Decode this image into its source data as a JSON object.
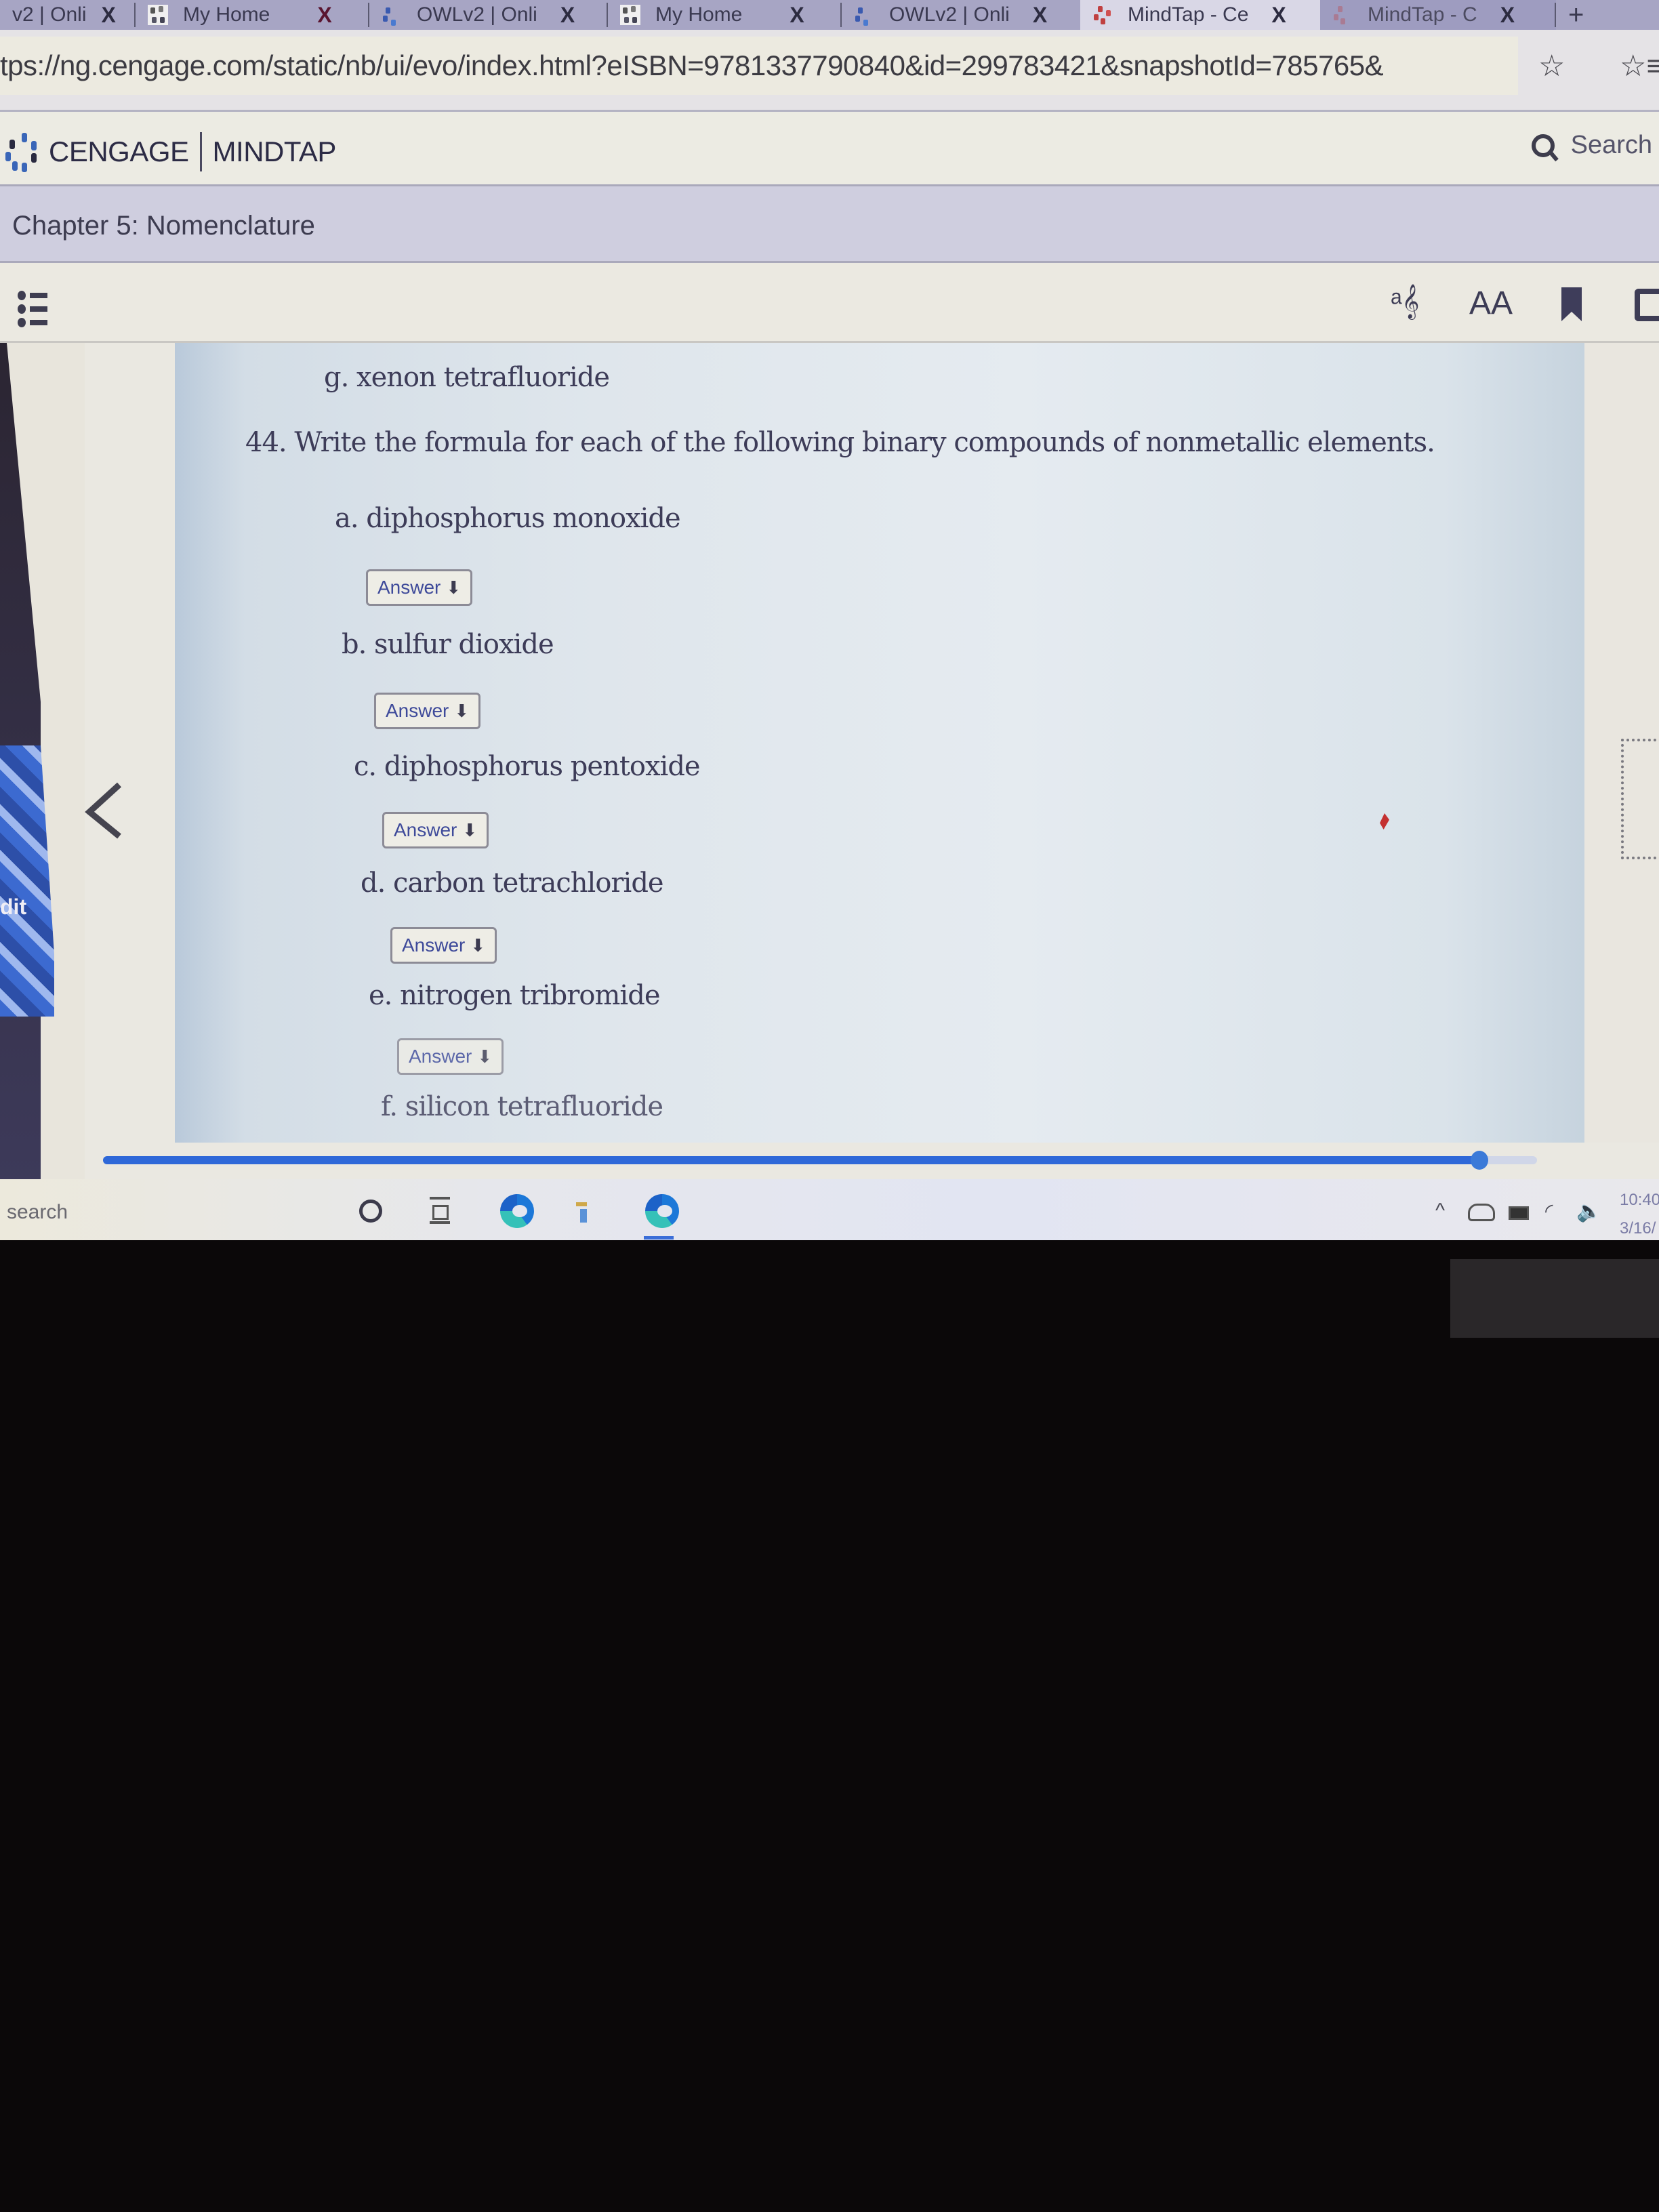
{
  "browser": {
    "tabs": [
      {
        "title": "v2 | Onli",
        "favicon": "owl-icon",
        "state": "normal"
      },
      {
        "title": "My Home",
        "favicon": "cengage-icon",
        "state": "normal"
      },
      {
        "title": "OWLv2 | Onli",
        "favicon": "owl-icon",
        "state": "normal"
      },
      {
        "title": "My Home",
        "favicon": "cengage-icon",
        "state": "normal"
      },
      {
        "title": "OWLv2 | Onli",
        "favicon": "owl-icon",
        "state": "normal"
      },
      {
        "title": "MindTap - Ce",
        "favicon": "mindtap-icon",
        "state": "active"
      },
      {
        "title": "MindTap - C",
        "favicon": "mindtap-icon",
        "state": "faded"
      }
    ],
    "close_glyph": "X",
    "new_tab_glyph": "+",
    "url": "tps://ng.cengage.com/static/nb/ui/evo/index.html?eISBN=9781337790840&id=299783421&snapshotId=785765&",
    "favorite_add_icon": "☆",
    "favorites_icon": "☆≡"
  },
  "app": {
    "brand_left": "CENGAGE",
    "brand_right": "MINDTAP",
    "search_label": "Search",
    "chapter_title": "Chapter 5: Nomenclature",
    "toolbar": {
      "read_aloud_icon": "ᵃ𝄞",
      "text_size_label": "AA"
    }
  },
  "content": {
    "prev_item": "g. xenon tetrafluoride",
    "question": "44. Write the formula for each of the following binary compounds of nonmetallic elements.",
    "answer_label": "Answer",
    "answer_arrow": "🡇",
    "items": [
      {
        "label": "a. diphosphorus monoxide",
        "has_answer": true
      },
      {
        "label": "b. sulfur dioxide",
        "has_answer": true
      },
      {
        "label": "c. diphosphorus pentoxide",
        "has_answer": true
      },
      {
        "label": "d. carbon tetrachloride",
        "has_answer": true
      },
      {
        "label": "e. nitrogen tribromide",
        "has_answer": true
      },
      {
        "label": "f. silicon tetrafluoride",
        "has_answer": false
      }
    ],
    "progress_fraction": 0.96
  },
  "desktop": {
    "edit_fragment": "dit",
    "taskbar_search": "search",
    "tray_chevron": "^",
    "clock_time": "10:40",
    "clock_date": "3/16/"
  },
  "colors": {
    "accent_blue": "#2f68d8",
    "answer_text": "#3e4a9a",
    "tab_strip": "#a7a5c4"
  }
}
